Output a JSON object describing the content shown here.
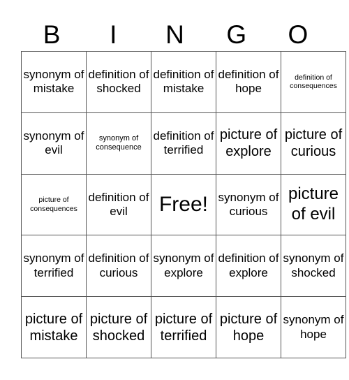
{
  "title_letters": [
    "B",
    "I",
    "N",
    "G",
    "O"
  ],
  "rows": [
    [
      {
        "text": "synonym of mistake",
        "size": "md"
      },
      {
        "text": "definition of shocked",
        "size": "md"
      },
      {
        "text": "definition of mistake",
        "size": "md"
      },
      {
        "text": "definition of hope",
        "size": "md"
      },
      {
        "text": "definition of consequences",
        "size": "xs"
      }
    ],
    [
      {
        "text": "synonym of evil",
        "size": "md"
      },
      {
        "text": "synonym of consequence",
        "size": "sm"
      },
      {
        "text": "definition of terrified",
        "size": "md"
      },
      {
        "text": "picture of explore",
        "size": "lg"
      },
      {
        "text": "picture of curious",
        "size": "lg"
      }
    ],
    [
      {
        "text": "picture of consequences",
        "size": "xs"
      },
      {
        "text": "definition of evil",
        "size": "md"
      },
      {
        "text": "Free!",
        "size": "free"
      },
      {
        "text": "synonym of curious",
        "size": "md"
      },
      {
        "text": "picture of evil",
        "size": "xl"
      }
    ],
    [
      {
        "text": "synonym of terrified",
        "size": "md"
      },
      {
        "text": "definition of curious",
        "size": "md"
      },
      {
        "text": "synonym of explore",
        "size": "md"
      },
      {
        "text": "definition of explore",
        "size": "md"
      },
      {
        "text": "synonym of shocked",
        "size": "md"
      }
    ],
    [
      {
        "text": "picture of mistake",
        "size": "lg"
      },
      {
        "text": "picture of shocked",
        "size": "lg"
      },
      {
        "text": "picture of terrified",
        "size": "lg"
      },
      {
        "text": "picture of hope",
        "size": "lg"
      },
      {
        "text": "synonym of hope",
        "size": "md"
      }
    ]
  ]
}
